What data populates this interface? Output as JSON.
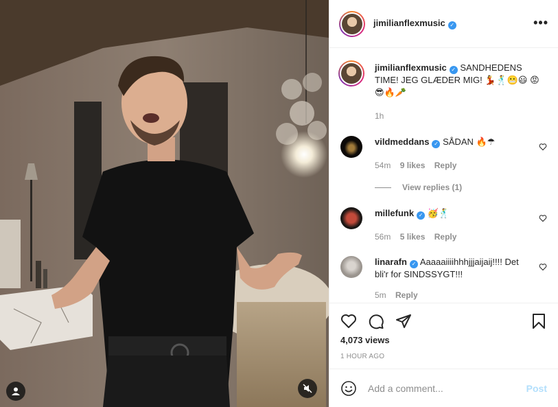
{
  "post": {
    "username": "jimilianflexmusic",
    "more_icon": "more-icon",
    "caption_text": "SANDHEDENS TIME! JEG GLÆDER MIG! 💃🕺😬😃 😡😎🔥🥕",
    "caption_time": "1h"
  },
  "comments": [
    {
      "username": "vildmeddans",
      "text": "SÅDAN 🔥☂",
      "time": "54m",
      "likes": "9 likes",
      "reply": "Reply",
      "view_replies": "View replies (1)"
    },
    {
      "username": "millefunk",
      "text": "🥳🕺",
      "time": "56m",
      "likes": "5 likes",
      "reply": "Reply"
    },
    {
      "username": "linarafn",
      "text": "Aaaaaiiiihhhjjjaijaij!!!! Det bli'r for SINDSSYGT!!!",
      "time": "5m",
      "reply": "Reply"
    }
  ],
  "stats": {
    "views": "4,073 views",
    "time_ago": "1 HOUR AGO"
  },
  "compose": {
    "placeholder": "Add a comment...",
    "post_label": "Post"
  },
  "colors": {
    "verified": "#3897f0",
    "post_disabled": "#b2dffc"
  }
}
